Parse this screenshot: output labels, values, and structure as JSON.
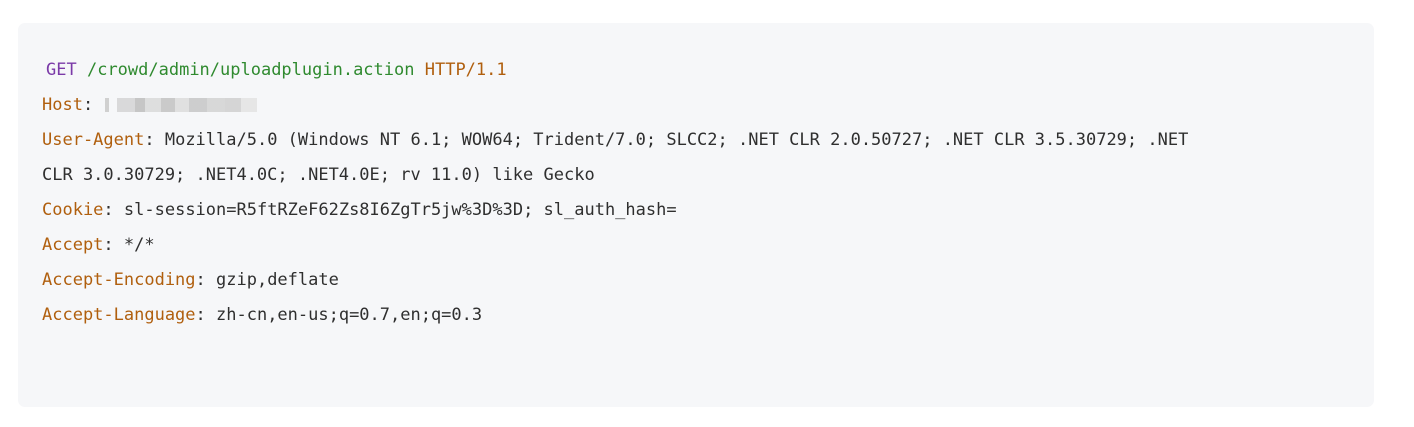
{
  "request_line": {
    "method": "GET",
    "path": "/crowd/admin/uploadplugin.action",
    "protocol": "HTTP/1.1"
  },
  "headers": [
    {
      "key": "Host",
      "sep": ": ",
      "value": ""
    },
    {
      "key": "User-Agent",
      "sep": ": ",
      "value": "Mozilla/5.0 (Windows NT 6.1; WOW64; Trident/7.0; SLCC2; .NET CLR 2.0.50727; .NET CLR 3.5.30729; .NET",
      "value_cont": "CLR 3.0.30729; .NET4.0C; .NET4.0E; rv 11.0) like Gecko"
    },
    {
      "key": "Cookie",
      "sep": ": ",
      "value": "sl-session=R5ftRZeF62Zs8I6ZgTr5jw%3D%3D; sl_auth_hash="
    },
    {
      "key": "Accept",
      "sep": ": ",
      "value": "*/*"
    },
    {
      "key": "Accept-Encoding",
      "sep": ": ",
      "value": "gzip,deflate"
    },
    {
      "key": "Accept-Language",
      "sep": ": ",
      "value": "zh-cn,en-us;q=0.7,en;q=0.3"
    }
  ]
}
